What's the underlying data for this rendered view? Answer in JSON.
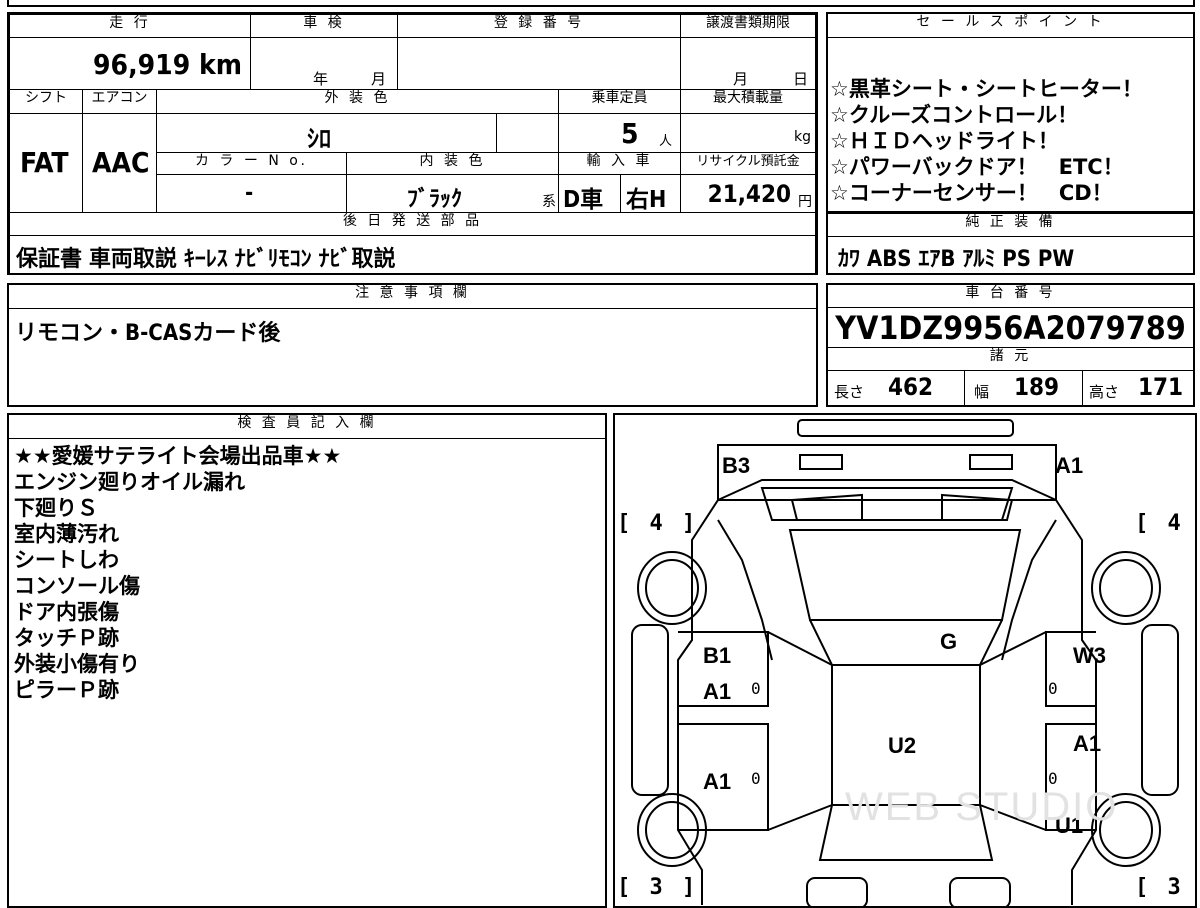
{
  "main_table": {
    "mileage_header": "走 行",
    "mileage_value": "96,919 km",
    "inspection_header": "車 検",
    "inspection_year": "年",
    "inspection_month": "月",
    "registration_header": "登 録 番 号",
    "transfer_header": "譲渡書類期限",
    "transfer_month": "月",
    "transfer_day": "日",
    "shift_header": "シフト",
    "shift_value": "FAT",
    "aircon_header": "エアコン",
    "aircon_value": "AAC",
    "exterior_header": "外 装 色",
    "exterior_value": "ｼﾛ",
    "capacity_header": "乗車定員",
    "capacity_value": "5",
    "capacity_unit": "人",
    "load_header": "最大積載量",
    "load_unit": "kg",
    "color_no_header": "カ ラ ー N o.",
    "color_no_value": "-",
    "interior_header": "内 装 色",
    "interior_value": "ﾌﾞﾗｯｸ",
    "interior_suffix": "系",
    "import_header": "輸 入 車",
    "import_value": "D車",
    "steering_value": "右H",
    "recycle_header": "リサイクル預託金",
    "recycle_value": "21,420",
    "recycle_unit": "円",
    "later_parts_header": "後 日 発 送 部 品",
    "later_parts_value": "保証書 車両取説 ｷｰﾚｽ ﾅﾋﾞﾘﾓｺﾝ ﾅﾋﾞ取説"
  },
  "sales_points": {
    "header": "セ ー ル ス ポ イ ン ト",
    "lines": [
      "☆黒革シート・シートヒーター！",
      "☆クルーズコントロール！",
      "☆ＨＩＤヘッドライト！",
      "☆パワーバックドア！　ETC！",
      "☆コーナーセンサー！　CD！"
    ]
  },
  "standard_equipment": {
    "header": "純 正 装 備",
    "value": "ｶﾜ ABS ｴｱB ｱﾙﾐ PS PW"
  },
  "notes": {
    "header": "注 意 事 項 欄",
    "value": "リモコン・B-CASカード後"
  },
  "chassis": {
    "header": "車 台 番 号",
    "value": "YV1DZ9956A2079789"
  },
  "specs": {
    "header": "諸 元",
    "length_label": "長さ",
    "length_value": "462",
    "width_label": "幅",
    "width_value": "189",
    "height_label": "高さ",
    "height_value": "171"
  },
  "inspector": {
    "header": "検 査 員 記 入 欄",
    "lines": [
      "★★愛媛サテライト会場出品車★★",
      "エンジン廻りオイル漏れ",
      "下廻りＳ",
      "室内薄汚れ",
      "シートしわ",
      "コンソール傷",
      "ドア内張傷",
      "タッチＰ跡",
      "外装小傷有り",
      "ピラーＰ跡"
    ]
  },
  "diagram": {
    "top_left": "B3",
    "top_right": "A1",
    "bracket_front_left": "[ 4 ]",
    "bracket_front_right": "[ 4 ]",
    "bracket_rear_left": "[ 3 ]",
    "bracket_rear_right": "[ 3 ]",
    "windshield": "G",
    "front_door_left_1": "B1",
    "front_door_left_2": "A1",
    "front_door_right": "W3",
    "roof": "U2",
    "rear_door_left": "A1",
    "rear_door_right": "A1",
    "rear_right_wheel": "U1",
    "zero_marks": [
      "0",
      "0",
      "0",
      "0"
    ],
    "watermark": "WEB STUDIO"
  }
}
